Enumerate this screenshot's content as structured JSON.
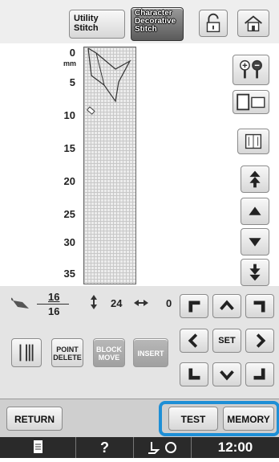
{
  "header": {
    "utility_tab": "Utility\nStitch",
    "character_tab": "Character\nDecorative\nStitch"
  },
  "ruler": {
    "unit": "mm",
    "marks": [
      "0",
      "5",
      "10",
      "15",
      "20",
      "25",
      "30",
      "35"
    ]
  },
  "info": {
    "stitch_current": "16",
    "stitch_total": "16",
    "height_value": "24",
    "width_value": "0"
  },
  "edit_buttons": {
    "point_delete": "POINT\nDELETE",
    "block_move": "BLOCK\nMOVE",
    "insert": "INSERT",
    "set": "SET"
  },
  "footer": {
    "return_label": "RETURN",
    "test_label": "TEST",
    "memory_label": "MEMORY"
  },
  "status": {
    "help": "?",
    "time": "12:00"
  },
  "colors": {
    "highlight": "#1e8fd6",
    "status_bar": "#2a2a2a"
  }
}
